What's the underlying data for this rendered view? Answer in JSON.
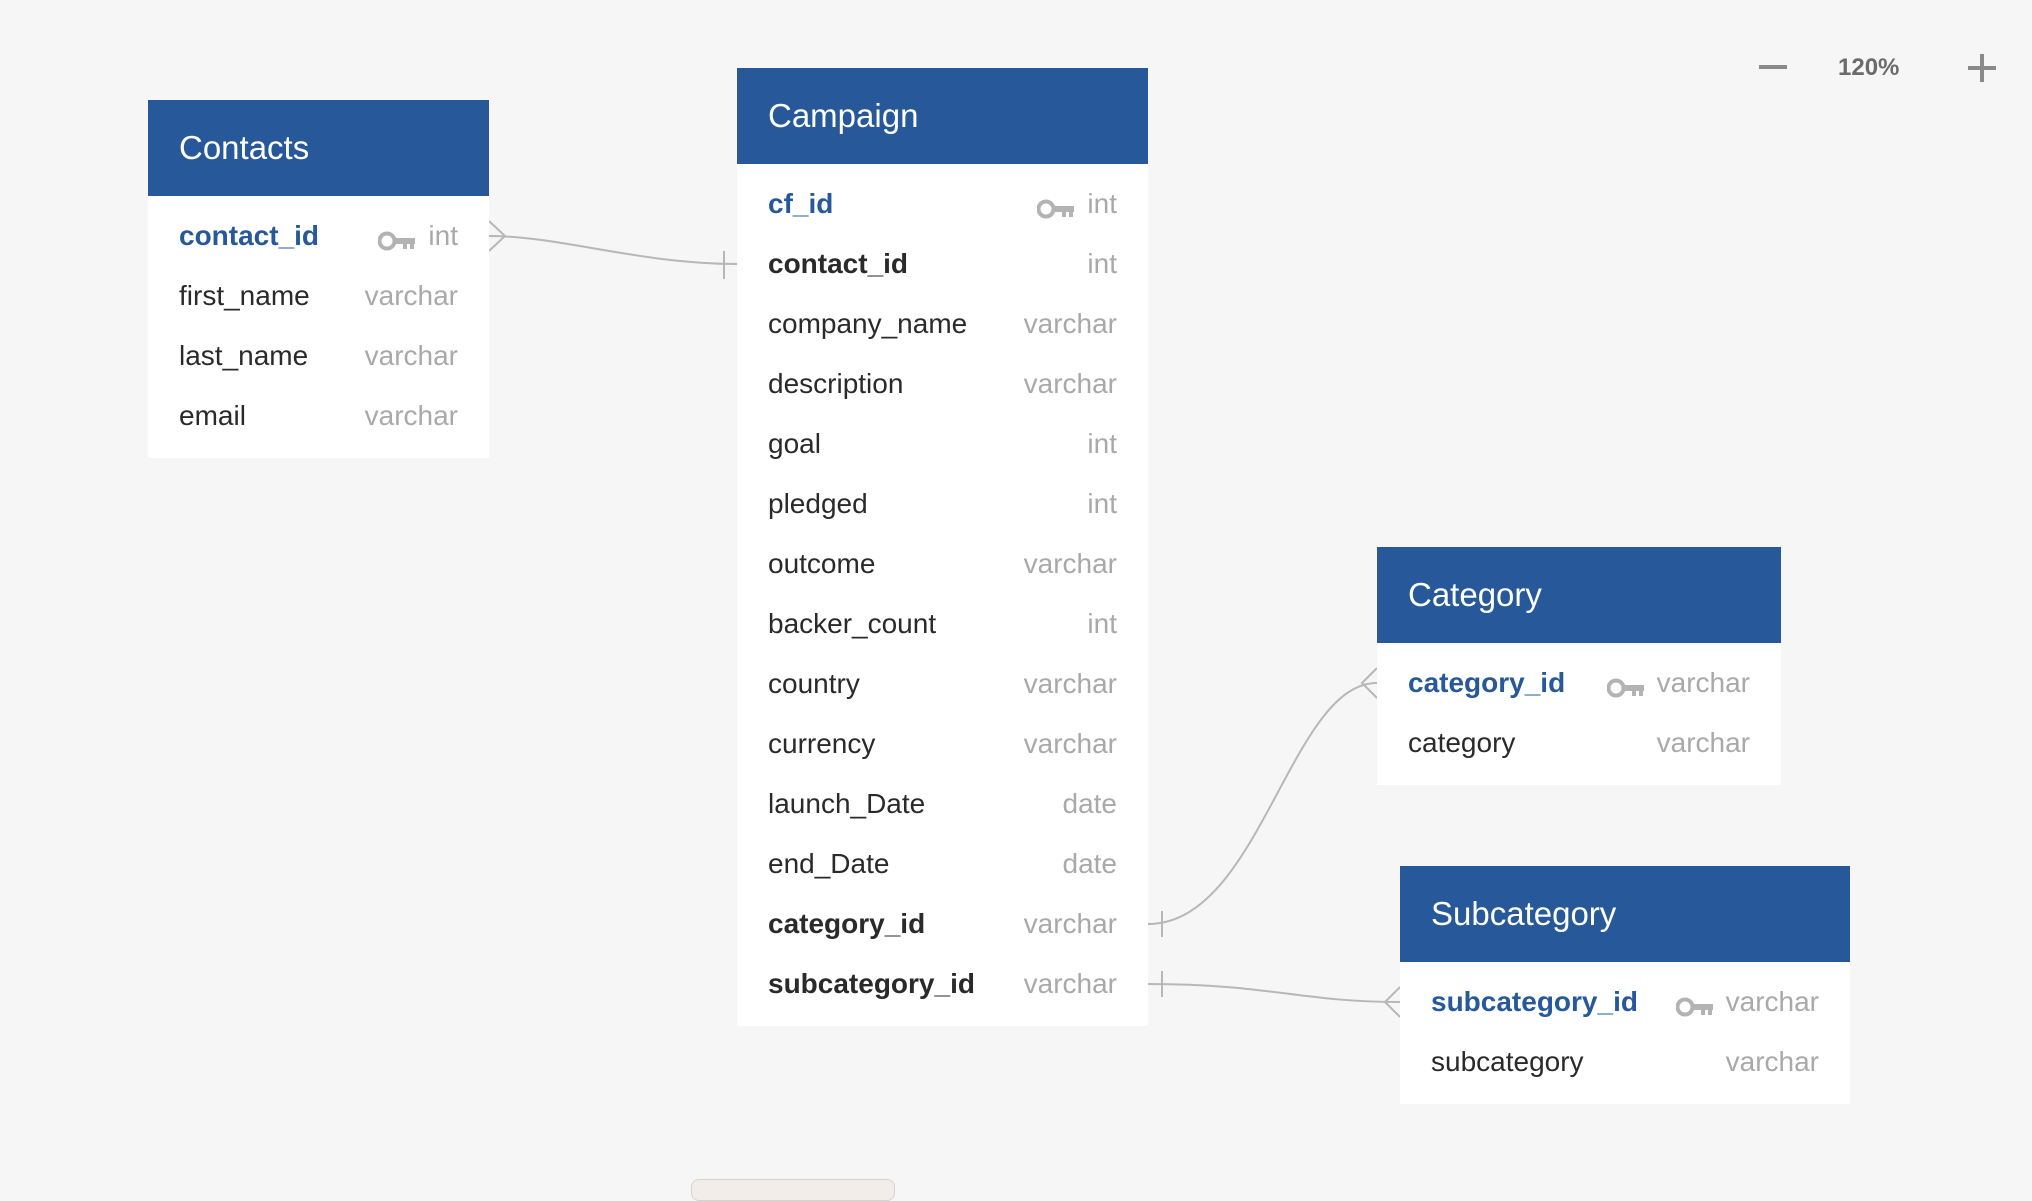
{
  "zoom": {
    "minus": "—",
    "level": "120%",
    "plus": "+"
  },
  "colors": {
    "header_bg": "#26589a",
    "primary_key_text": "#26589a",
    "type_text": "#a9a9a9",
    "canvas_bg": "#f5f6f5",
    "relationship_line": "#b7b7b7"
  },
  "tables": {
    "contacts": {
      "title": "Contacts",
      "fields": [
        {
          "name": "contact_id",
          "type": "int",
          "kind": "pk"
        },
        {
          "name": "first_name",
          "type": "varchar",
          "kind": "normal"
        },
        {
          "name": "last_name",
          "type": "varchar",
          "kind": "normal"
        },
        {
          "name": "email",
          "type": "varchar",
          "kind": "normal"
        }
      ]
    },
    "campaign": {
      "title": "Campaign",
      "fields": [
        {
          "name": "cf_id",
          "type": "int",
          "kind": "pk"
        },
        {
          "name": "contact_id",
          "type": "int",
          "kind": "fk"
        },
        {
          "name": "company_name",
          "type": "varchar",
          "kind": "normal"
        },
        {
          "name": "description",
          "type": "varchar",
          "kind": "normal"
        },
        {
          "name": "goal",
          "type": "int",
          "kind": "normal"
        },
        {
          "name": "pledged",
          "type": "int",
          "kind": "normal"
        },
        {
          "name": "outcome",
          "type": "varchar",
          "kind": "normal"
        },
        {
          "name": "backer_count",
          "type": "int",
          "kind": "normal"
        },
        {
          "name": "country",
          "type": "varchar",
          "kind": "normal"
        },
        {
          "name": "currency",
          "type": "varchar",
          "kind": "normal"
        },
        {
          "name": "launch_Date",
          "type": "date",
          "kind": "normal"
        },
        {
          "name": "end_Date",
          "type": "date",
          "kind": "normal"
        },
        {
          "name": "category_id",
          "type": "varchar",
          "kind": "fk"
        },
        {
          "name": "subcategory_id",
          "type": "varchar",
          "kind": "fk"
        }
      ]
    },
    "category": {
      "title": "Category",
      "fields": [
        {
          "name": "category_id",
          "type": "varchar",
          "kind": "pk"
        },
        {
          "name": "category",
          "type": "varchar",
          "kind": "normal"
        }
      ]
    },
    "subcategory": {
      "title": "Subcategory",
      "fields": [
        {
          "name": "subcategory_id",
          "type": "varchar",
          "kind": "pk"
        },
        {
          "name": "subcategory",
          "type": "varchar",
          "kind": "normal"
        }
      ]
    }
  }
}
